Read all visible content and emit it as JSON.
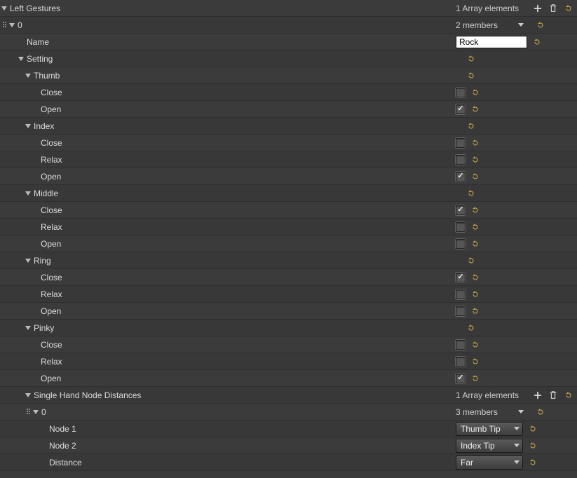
{
  "root": {
    "label": "Left Gestures",
    "array_summary": "1 Array elements"
  },
  "item0": {
    "label": "0",
    "members": "2 members"
  },
  "name": {
    "label": "Name",
    "value": "Rock"
  },
  "setting": {
    "label": "Setting"
  },
  "fingers": [
    {
      "name": "Thumb",
      "rows": [
        {
          "label": "Close",
          "checked": false
        },
        {
          "label": "Open",
          "checked": true
        }
      ]
    },
    {
      "name": "Index",
      "rows": [
        {
          "label": "Close",
          "checked": false
        },
        {
          "label": "Relax",
          "checked": false
        },
        {
          "label": "Open",
          "checked": true
        }
      ]
    },
    {
      "name": "Middle",
      "rows": [
        {
          "label": "Close",
          "checked": true
        },
        {
          "label": "Relax",
          "checked": false
        },
        {
          "label": "Open",
          "checked": false
        }
      ]
    },
    {
      "name": "Ring",
      "rows": [
        {
          "label": "Close",
          "checked": true
        },
        {
          "label": "Relax",
          "checked": false
        },
        {
          "label": "Open",
          "checked": false
        }
      ]
    },
    {
      "name": "Pinky",
      "rows": [
        {
          "label": "Close",
          "checked": false
        },
        {
          "label": "Relax",
          "checked": false
        },
        {
          "label": "Open",
          "checked": true
        }
      ]
    }
  ],
  "distances": {
    "label": "Single Hand Node Distances",
    "array_summary": "1 Array elements",
    "item0": {
      "label": "0",
      "members": "3 members"
    },
    "node1": {
      "label": "Node 1",
      "value": "Thumb Tip"
    },
    "node2": {
      "label": "Node 2",
      "value": "Index Tip"
    },
    "distance": {
      "label": "Distance",
      "value": "Far"
    }
  }
}
